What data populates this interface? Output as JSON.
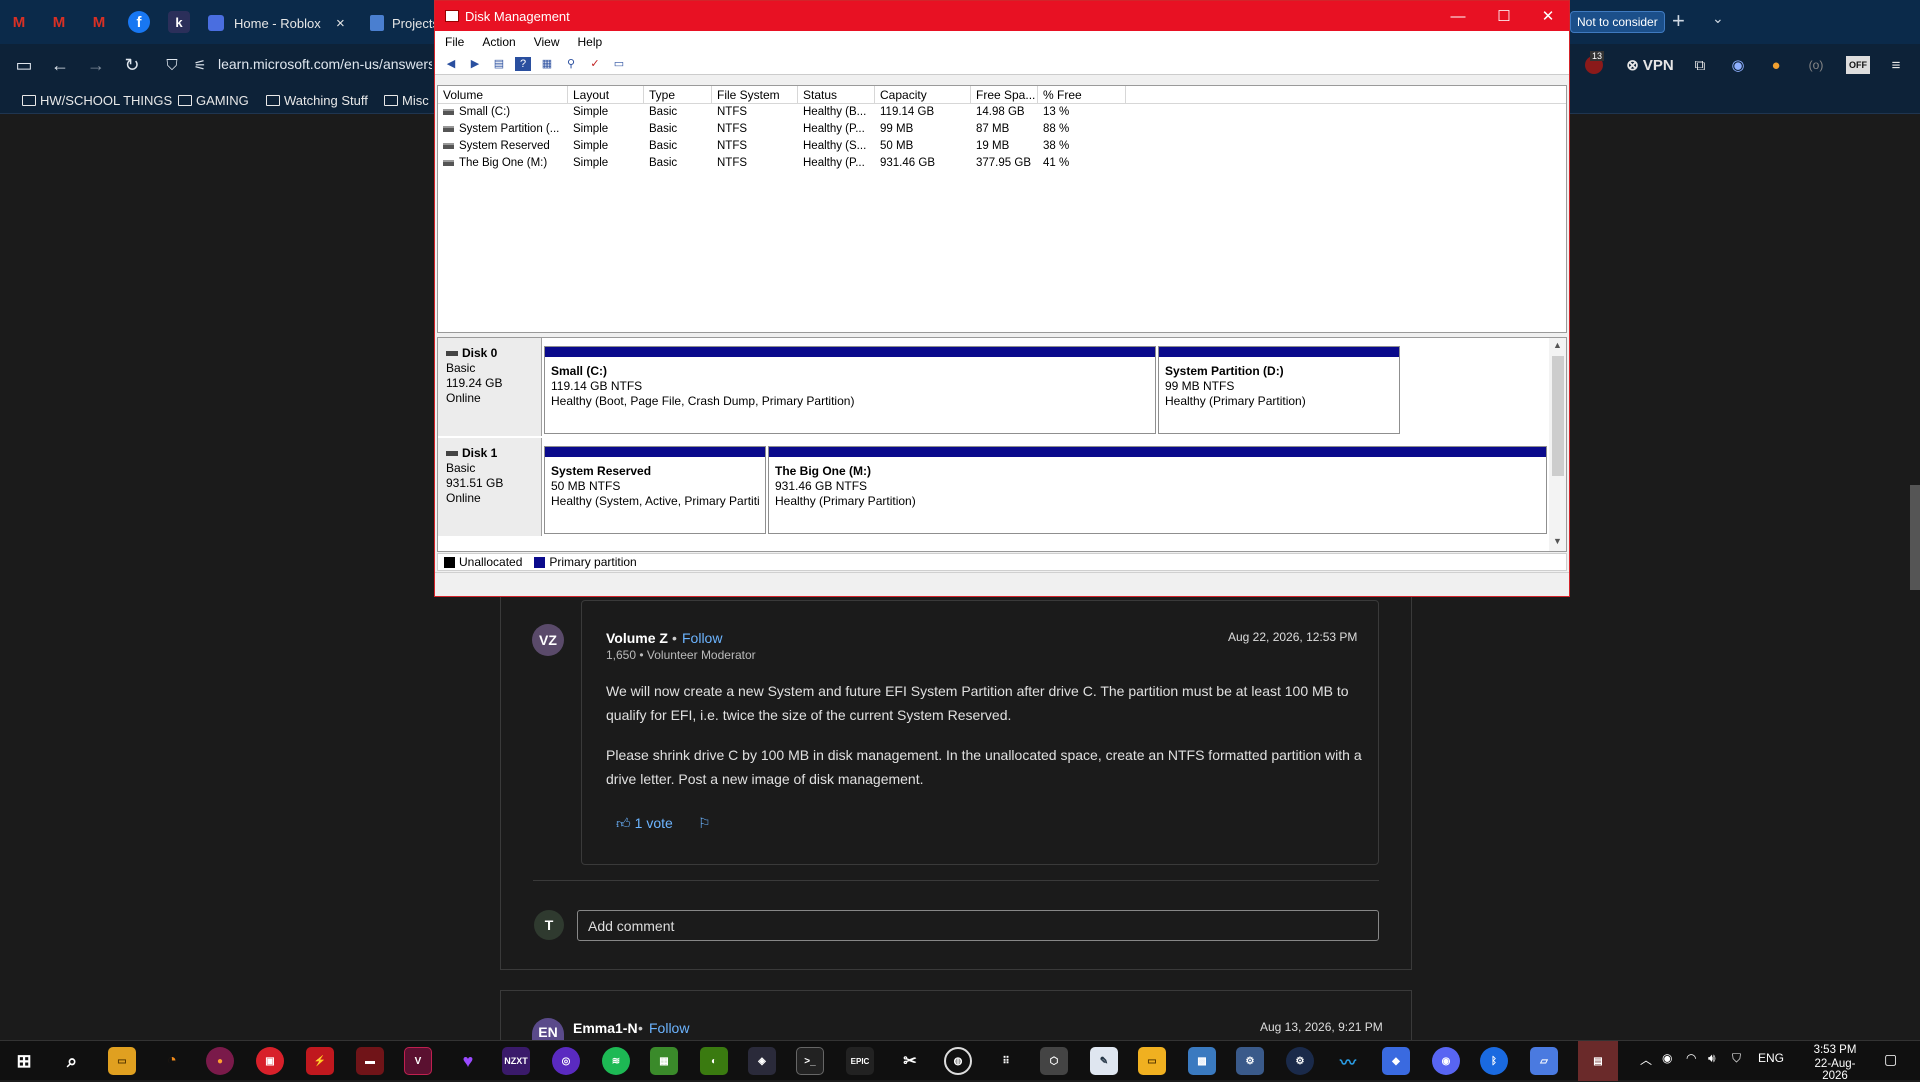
{
  "browser": {
    "tabs": [
      {
        "label": "Home - Roblox",
        "close": "×"
      },
      {
        "label": "Projects"
      }
    ],
    "right_tab": "Not to consider",
    "new_tab": "+",
    "url": "learn.microsoft.com/en-us/answers",
    "vpn_label": "VPN",
    "badge_count": "13",
    "off_label": "OFF",
    "bookmarks": [
      "HW/SCHOOL THINGS",
      "GAMING",
      "Watching Stuff",
      "Misc"
    ]
  },
  "disk_management": {
    "title": "Disk Management",
    "menu": [
      "File",
      "Action",
      "View",
      "Help"
    ],
    "columns": [
      "Volume",
      "Layout",
      "Type",
      "File System",
      "Status",
      "Capacity",
      "Free Spa...",
      "% Free"
    ],
    "volumes": [
      {
        "volume": "Small (C:)",
        "layout": "Simple",
        "type": "Basic",
        "fs": "NTFS",
        "status": "Healthy (B...",
        "capacity": "119.14 GB",
        "free": "14.98 GB",
        "pct": "13 %"
      },
      {
        "volume": "System Partition (...",
        "layout": "Simple",
        "type": "Basic",
        "fs": "NTFS",
        "status": "Healthy (P...",
        "capacity": "99 MB",
        "free": "87 MB",
        "pct": "88 %"
      },
      {
        "volume": "System Reserved",
        "layout": "Simple",
        "type": "Basic",
        "fs": "NTFS",
        "status": "Healthy (S...",
        "capacity": "50 MB",
        "free": "19 MB",
        "pct": "38 %"
      },
      {
        "volume": "The Big One (M:)",
        "layout": "Simple",
        "type": "Basic",
        "fs": "NTFS",
        "status": "Healthy (P...",
        "capacity": "931.46 GB",
        "free": "377.95 GB",
        "pct": "41 %"
      }
    ],
    "disks": [
      {
        "name": "Disk 0",
        "kind": "Basic",
        "size": "119.24 GB",
        "state": "Online",
        "partitions": [
          {
            "name": "Small  (C:)",
            "size": "119.14 GB NTFS",
            "status": "Healthy (Boot, Page File, Crash Dump, Primary Partition)"
          },
          {
            "name": "System Partition  (D:)",
            "size": "99 MB NTFS",
            "status": "Healthy (Primary Partition)"
          }
        ]
      },
      {
        "name": "Disk 1",
        "kind": "Basic",
        "size": "931.51 GB",
        "state": "Online",
        "partitions": [
          {
            "name": "System Reserved",
            "size": "50 MB NTFS",
            "status": "Healthy (System, Active, Primary Partiti"
          },
          {
            "name": "The Big One  (M:)",
            "size": "931.46 GB NTFS",
            "status": "Healthy (Primary Partition)"
          }
        ]
      }
    ],
    "legend": [
      "Unallocated",
      "Primary partition"
    ],
    "colors": {
      "unallocated": "#000000",
      "primary": "#0a0a8c",
      "titlebar": "#e81123"
    }
  },
  "post": {
    "avatar": "VZ",
    "author": "Volume Z",
    "follow": "Follow",
    "dot": "•",
    "meta": "1,650 • Volunteer Moderator",
    "date": "Aug 22, 2026, 12:53 PM",
    "para1_l1": "We will now create a new System and future EFI System Partition after drive C. The partition must be at least 100 MB to",
    "para1_l2": "qualify for EFI, i.e. twice the size of the current System Reserved.",
    "para2_l1": "Please shrink drive C by 100 MB in disk management. In the unallocated space, create an NTFS formatted partition with a",
    "para2_l2": "drive letter. Post a new image of disk management.",
    "votes": "1 vote"
  },
  "comment": {
    "avatar": "T",
    "placeholder": "Add comment"
  },
  "next_post": {
    "avatar": "EN",
    "author": "Emma1-N",
    "follow": "Follow",
    "date": "Aug 13, 2026, 9:21 PM"
  },
  "taskbar": {
    "time": "3:53 PM",
    "date": "22-Aug-2026",
    "lang": "ENG",
    "icons": [
      "NZXT",
      "EPIC"
    ]
  }
}
